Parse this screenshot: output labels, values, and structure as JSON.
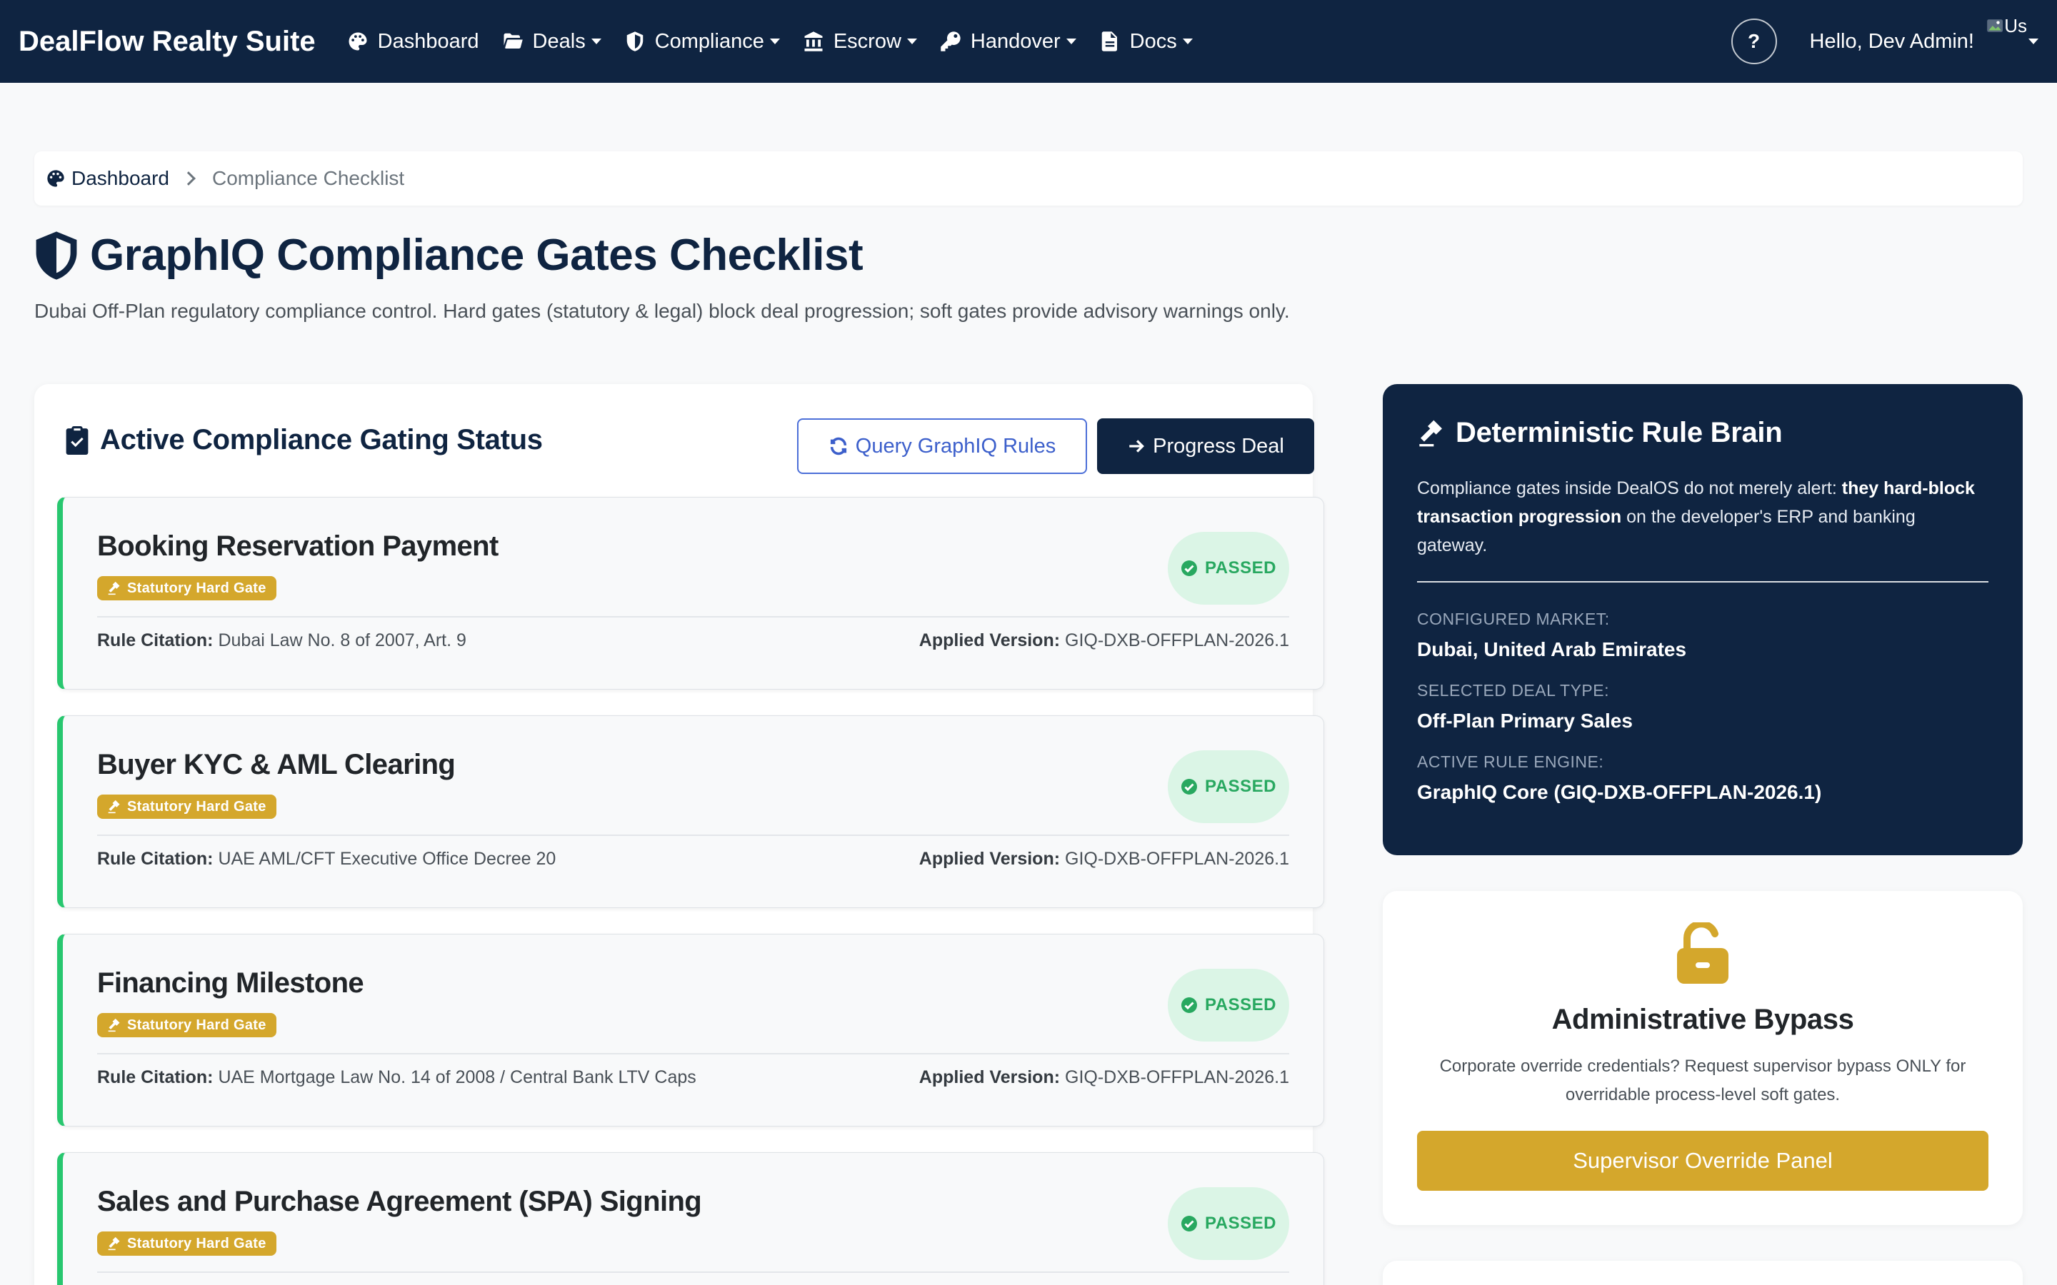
{
  "navbar": {
    "brand": "DealFlow Realty Suite",
    "items": [
      {
        "label": "Dashboard",
        "icon": "palette-icon",
        "dropdown": false
      },
      {
        "label": "Deals",
        "icon": "folder-icon",
        "dropdown": true
      },
      {
        "label": "Compliance",
        "icon": "shield-icon",
        "dropdown": true
      },
      {
        "label": "Escrow",
        "icon": "bank-icon",
        "dropdown": true
      },
      {
        "label": "Handover",
        "icon": "key-icon",
        "dropdown": true
      },
      {
        "label": "Docs",
        "icon": "document-icon",
        "dropdown": true
      }
    ],
    "help_label": "?",
    "greeting": "Hello, Dev Admin!",
    "avatar_alt": "Us"
  },
  "breadcrumb": {
    "home": "Dashboard",
    "current": "Compliance Checklist"
  },
  "page": {
    "title": "GraphIQ Compliance Gates Checklist",
    "subtitle": "Dubai Off-Plan regulatory compliance control. Hard gates (statutory & legal) block deal progression; soft gates provide advisory warnings only."
  },
  "gating": {
    "title": "Active Compliance Gating Status",
    "query_button": "Query GraphIQ Rules",
    "progress_button": "Progress Deal",
    "citation_label": "Rule Citation:",
    "version_label": "Applied Version:",
    "gates": [
      {
        "name": "Booking Reservation Payment",
        "badge": "Statutory Hard Gate",
        "status": "PASSED",
        "citation": "Dubai Law No. 8 of 2007, Art. 9",
        "version": "GIQ-DXB-OFFPLAN-2026.1"
      },
      {
        "name": "Buyer KYC & AML Clearing",
        "badge": "Statutory Hard Gate",
        "status": "PASSED",
        "citation": "UAE AML/CFT Executive Office Decree 20",
        "version": "GIQ-DXB-OFFPLAN-2026.1"
      },
      {
        "name": "Financing Milestone",
        "badge": "Statutory Hard Gate",
        "status": "PASSED",
        "citation": "UAE Mortgage Law No. 14 of 2008 / Central Bank LTV Caps",
        "version": "GIQ-DXB-OFFPLAN-2026.1"
      },
      {
        "name": "Sales and Purchase Agreement (SPA) Signing",
        "badge": "Statutory Hard Gate",
        "status": "PASSED",
        "citation": "",
        "version": ""
      }
    ]
  },
  "rule_brain": {
    "title": "Deterministic Rule Brain",
    "desc_1": "Compliance gates inside DealOS do not merely alert: ",
    "desc_bold": "they hard-block transaction progression",
    "desc_2": " on the developer's ERP and banking gateway.",
    "market_label": "CONFIGURED MARKET:",
    "market_value": "Dubai, United Arab Emirates",
    "deal_type_label": "SELECTED DEAL TYPE:",
    "deal_type_value": "Off-Plan Primary Sales",
    "engine_label": "ACTIVE RULE ENGINE:",
    "engine_value": "GraphIQ Core (GIQ-DXB-OFFPLAN-2026.1)"
  },
  "bypass": {
    "title": "Administrative Bypass",
    "desc": "Corporate override credentials? Request supervisor bypass ONLY for overridable process-level soft gates.",
    "button": "Supervisor Override Panel"
  },
  "colors": {
    "navy": "#0f2441",
    "gold": "#d4a72c",
    "success": "#28c76f",
    "accent_blue": "#3c5fcb"
  }
}
